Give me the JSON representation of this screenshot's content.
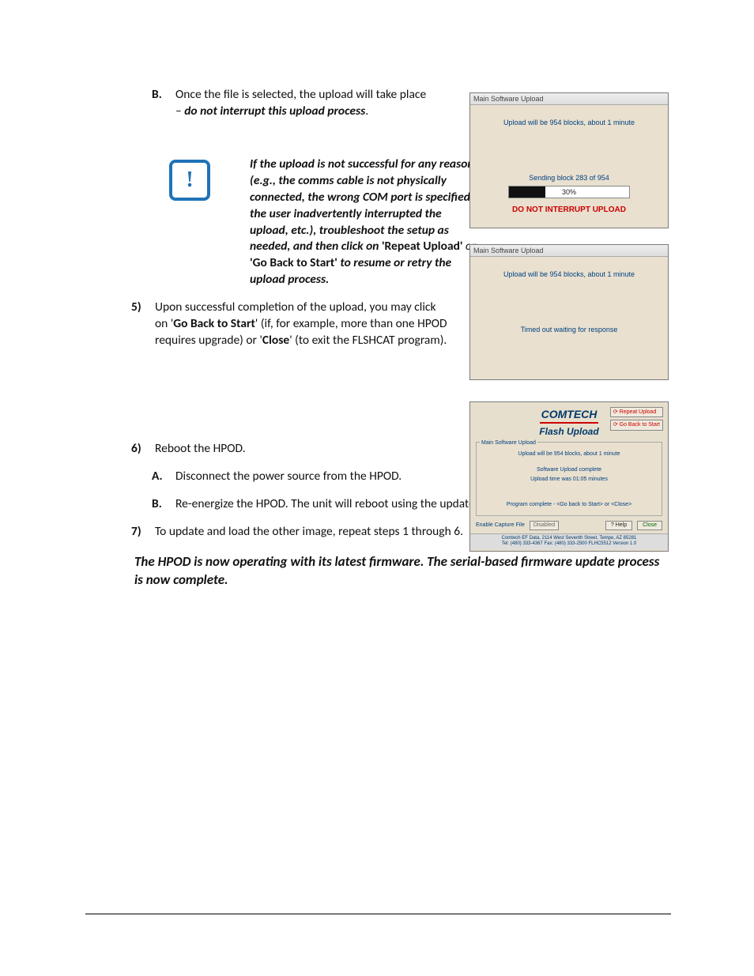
{
  "text": {
    "B_intro_pre": "Once the file is selected, the upload will take place – ",
    "B_intro_bold": "do not interrupt this upload process",
    "B_intro_post": ".",
    "note_pre": "If the upload is not successful for any reason (e.g., the comms cable is not physically connected, the wrong COM port is specified, the user inadvertently interrupted the upload, etc.), troubleshoot the setup as needed, and then click on ",
    "note_b1": "'Repeat Upload'",
    "note_or": " or ",
    "note_b2": "'Go Back to Start'",
    "note_post": " to resume or retry the upload process.",
    "s5_a": "Upon successful completion of the upload, you may click on '",
    "s5_b": "Go Back to Start",
    "s5_c": "' (if, for example, more than one HPOD requires upgrade) or '",
    "s5_d": "Close",
    "s5_e": "' (to exit the FLSHCAT program).",
    "s6": "Reboot the HPOD.",
    "s6a": "Disconnect the power source from the HPOD.",
    "s6b": "Re-energize the HPOD. The unit will reboot using the updated firmware image.",
    "s7": "To update and load the other image, repeat steps 1 through 6.",
    "final": "The HPOD is now operating with its latest firmware. The serial-based firmware update process is now complete."
  },
  "markers": {
    "B": "B.",
    "A": "A.",
    "n5": "5)",
    "n6": "6)",
    "n7": "7)"
  },
  "shot1": {
    "title": "Main Software Upload",
    "line1": "Upload will be 954 blocks, about 1 minute",
    "line2": "Sending block 283 of 954",
    "pct": "30%",
    "warn": "DO NOT INTERRUPT UPLOAD"
  },
  "shot2": {
    "title": "Main Software Upload",
    "line1": "Upload will be 954 blocks, about 1 minute",
    "line2": "Timed out waiting for response"
  },
  "shot3": {
    "logo": "COMTECH",
    "sub": "Flash Upload",
    "btn1": "Repeat Upload",
    "btn2": "Go Back to Start",
    "panel_t": "Main Software Upload",
    "p1": "Upload will be 954 blocks, about 1 minute",
    "p2": "Software Upload complete",
    "p3": "Upload time was 01:05 minutes",
    "p4": "Program complete - <Go back to Start> or <Close>",
    "ecf": "Enable Capture File",
    "dis": "Disabled",
    "help": "? Help",
    "close": "Close",
    "foot1": "Comtech EF Data, 2114 West Seventh Street, Tempe, AZ 85281",
    "foot2": "Tel: (480) 333-4367    Fax: (480) 333-2500    FLHC5512   Version 1.0"
  }
}
